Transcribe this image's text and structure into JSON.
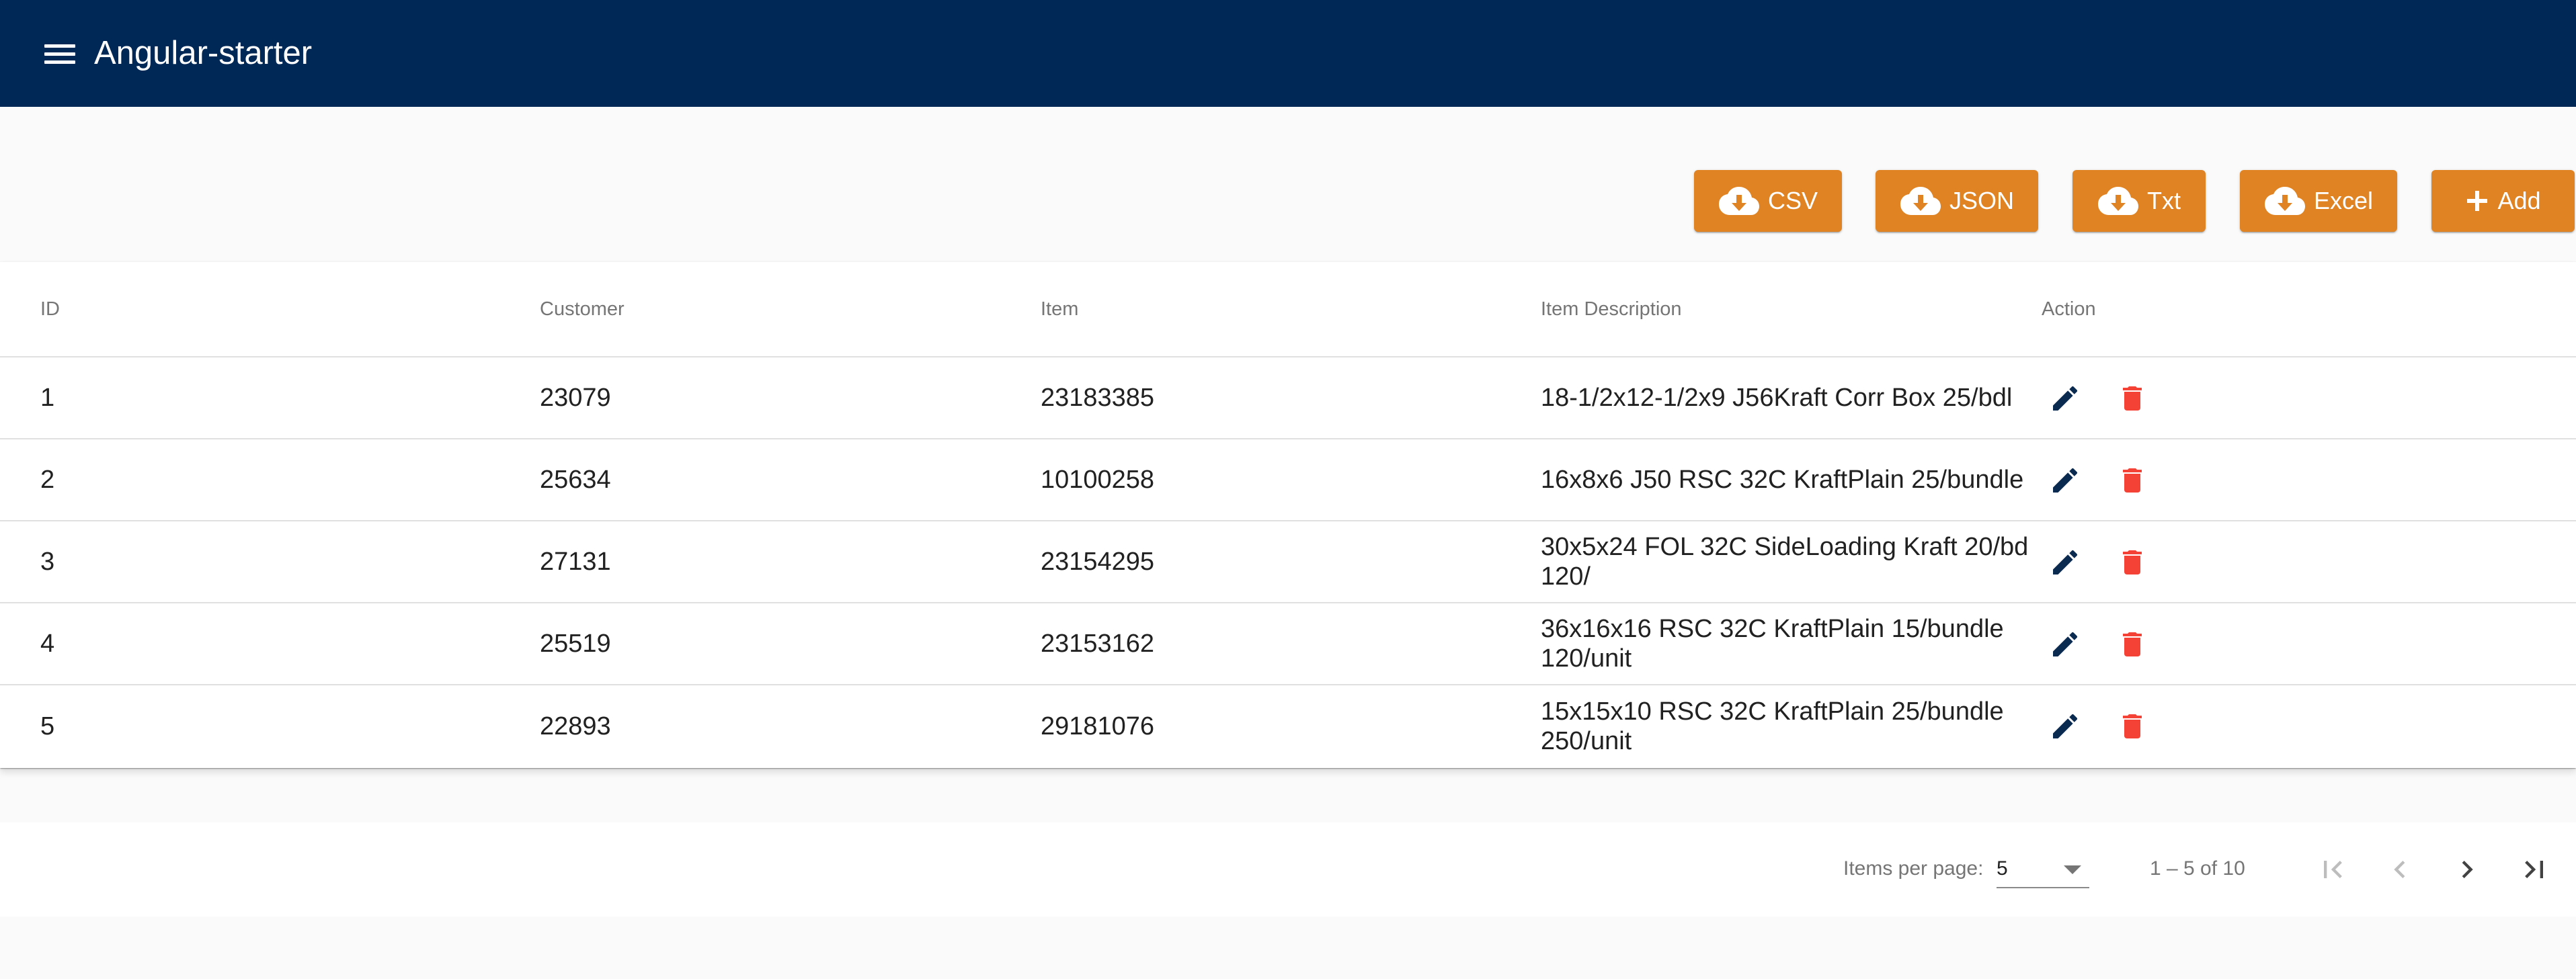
{
  "app": {
    "title": "Angular-starter"
  },
  "actions": {
    "csv_label": "CSV",
    "json_label": "JSON",
    "txt_label": "Txt",
    "excel_label": "Excel",
    "add_label": "Add"
  },
  "table": {
    "headers": {
      "id": "ID",
      "customer": "Customer",
      "item": "Item",
      "description": "Item Description",
      "action": "Action"
    },
    "rows": [
      {
        "id": "1",
        "customer": "23079",
        "item": "23183385",
        "description": "18-1/2x12-1/2x9 J56Kraft Corr Box 25/bdl"
      },
      {
        "id": "2",
        "customer": "25634",
        "item": "10100258",
        "description": "16x8x6 J50 RSC 32C KraftPlain 25/bundle"
      },
      {
        "id": "3",
        "customer": "27131",
        "item": "23154295",
        "description": "30x5x24 FOL 32C SideLoading Kraft 20/bd 120/"
      },
      {
        "id": "4",
        "customer": "25519",
        "item": "23153162",
        "description": "36x16x16 RSC 32C KraftPlain 15/bundle 120/unit"
      },
      {
        "id": "5",
        "customer": "22893",
        "item": "29181076",
        "description": "15x15x10 RSC 32C KraftPlain 25/bundle 250/unit"
      }
    ]
  },
  "paginator": {
    "items_per_page_label": "Items per page:",
    "page_size": "5",
    "range_label": "1 – 5 of 10"
  },
  "colors": {
    "toolbar": "#002856",
    "button": "#e08323",
    "edit_icon": "#0b2a50",
    "delete_icon": "#f44336"
  },
  "icons": {
    "menu": "menu-icon",
    "download": "cloud-download-icon",
    "add": "plus-icon",
    "edit": "pencil-icon",
    "delete": "trash-icon",
    "first_page": "first-page-icon",
    "prev_page": "chevron-left-icon",
    "next_page": "chevron-right-icon",
    "last_page": "last-page-icon"
  }
}
